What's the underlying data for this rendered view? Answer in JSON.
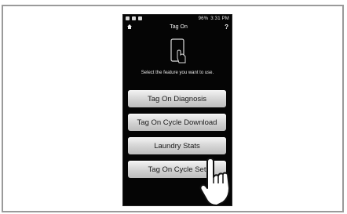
{
  "status": {
    "time": "3:31 PM",
    "battery": "96%",
    "icons_left": [
      "notification-icon",
      "notification-icon",
      "signal-icon",
      "app-icon"
    ]
  },
  "header": {
    "title": "Tag On",
    "help": "?"
  },
  "instruction": "Select the feature you want to use.",
  "buttons": [
    {
      "label": "Tag On Diagnosis"
    },
    {
      "label": "Tag On Cycle Download"
    },
    {
      "label": "Laundry Stats"
    },
    {
      "label": "Tag On Cycle Set"
    }
  ]
}
